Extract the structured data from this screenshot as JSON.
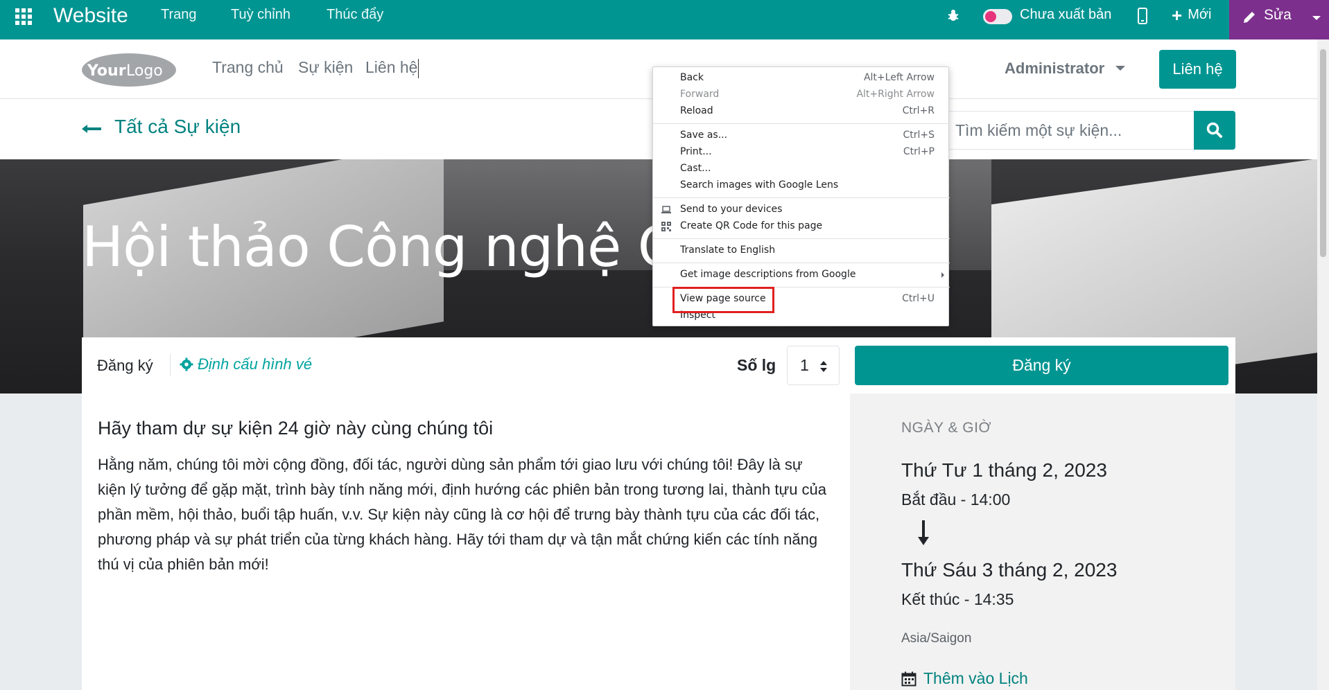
{
  "topbar": {
    "brand": "Website",
    "nav": [
      "Trang",
      "Tuỳ chỉnh",
      "Thúc đẩy"
    ],
    "publish_status": "Chưa xuất bản",
    "new_label": "Mới",
    "edit_label": "Sửa",
    "colors": {
      "bar": "#019592",
      "edit": "#7c2f8d",
      "toggle_knob": "#e7357b"
    }
  },
  "header": {
    "logo_alt": "YourLogo",
    "nav": [
      "Trang chủ",
      "Sự kiện",
      "Liên hệ"
    ],
    "user": "Administrator",
    "contact_button": "Liên hệ"
  },
  "backrow": {
    "back_label": "Tất cả Sự kiện",
    "search_placeholder": "Tìm kiếm một sự kiện..."
  },
  "hero": {
    "title": "Hội thảo Công nghệ Chung"
  },
  "registration": {
    "label": "Đăng ký",
    "config_link": "Định cấu hình vé",
    "qty_label": "Số lg",
    "qty_value": "1",
    "register_button": "Đăng ký"
  },
  "content": {
    "intro_title": "Hãy tham dự sự kiện 24 giờ này cùng chúng tôi",
    "intro_text": "Hằng năm, chúng tôi mời cộng đồng, đối tác, người dùng sản phẩm tới giao lưu với chúng tôi! Đây là sự kiện lý tưởng để gặp mặt, trình bày tính năng mới, định hướng các phiên bản trong tương lai, thành tựu của phần mềm, hội thảo, buổi tập huấn, v.v. Sự kiện này cũng là cơ hội để trưng bày thành tựu của các đối tác, phương pháp và sự phát triển của từng khách hàng. Hãy tới tham dự và tận mắt chứng kiến các tính năng thú vị của phiên bản mới!"
  },
  "sidebar": {
    "heading": "NGÀY & GIỜ",
    "start_date": "Thứ Tư 1 tháng 2, 2023",
    "start_time": "Bắt đầu - 14:00",
    "end_date": "Thứ Sáu 3 tháng 2, 2023",
    "end_time": "Kết thúc - 14:35",
    "timezone": "Asia/Saigon",
    "add_calendar": "Thêm vào Lịch"
  },
  "context_menu": {
    "items": [
      {
        "label": "Back",
        "shortcut": "Alt+Left Arrow"
      },
      {
        "label": "Forward",
        "shortcut": "Alt+Right Arrow"
      },
      {
        "label": "Reload",
        "shortcut": "Ctrl+R"
      },
      {
        "label": "Save as...",
        "shortcut": "Ctrl+S"
      },
      {
        "label": "Print...",
        "shortcut": "Ctrl+P"
      },
      {
        "label": "Cast..."
      },
      {
        "label": "Search images with Google Lens"
      },
      {
        "label": "Send to your devices"
      },
      {
        "label": "Create QR Code for this page"
      },
      {
        "label": "Translate to English"
      },
      {
        "label": "Get image descriptions from Google"
      },
      {
        "label": "View page source",
        "shortcut": "Ctrl+U"
      },
      {
        "label": "Inspect"
      }
    ],
    "highlight_color": "#e0201f"
  }
}
